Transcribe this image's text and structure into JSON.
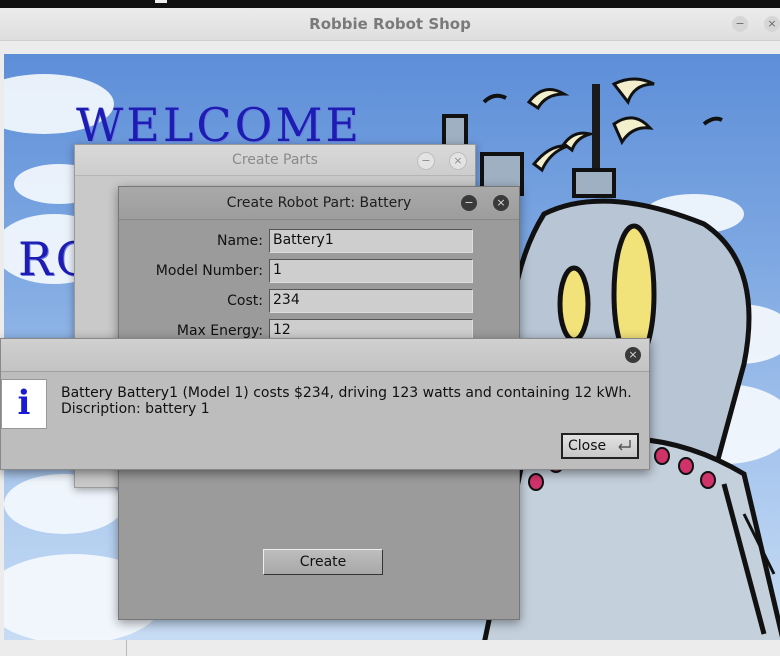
{
  "main_window": {
    "title": "Robbie Robot Shop",
    "welcome_text": "WELCOME",
    "partial_text": "RO"
  },
  "parts_window": {
    "title": "Create Parts"
  },
  "part_dialog": {
    "title": "Create Robot Part: Battery",
    "fields": [
      {
        "label": "Name:",
        "value": "Battery1"
      },
      {
        "label": "Model Number:",
        "value": "1"
      },
      {
        "label": "Cost:",
        "value": "234"
      },
      {
        "label": "Max Energy:",
        "value": "12"
      }
    ],
    "create_label": "Create"
  },
  "info_dialog": {
    "icon_glyph": "i",
    "line1": "Battery Battery1 (Model 1) costs $234, driving 123 watts and containing 12  kWh.",
    "line2": "Discription: battery 1",
    "close_label": "Close"
  }
}
